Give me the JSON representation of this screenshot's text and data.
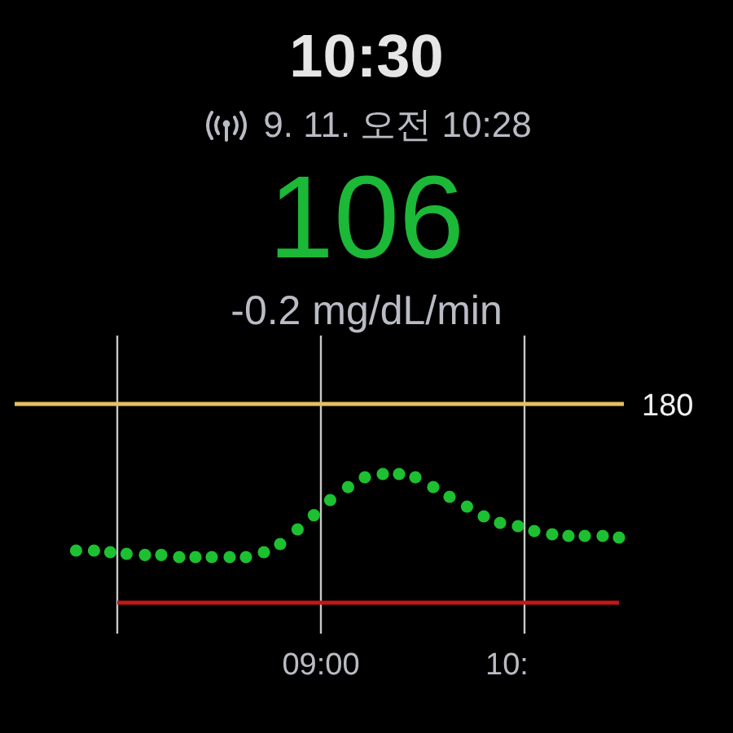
{
  "clock": "10:30",
  "status": {
    "timestamp": "9. 11. 오전 10:28"
  },
  "glucose": {
    "value": "106",
    "rate": "-0.2 mg/dL/min"
  },
  "chart": {
    "high_label": "180",
    "time_labels": [
      "09:00",
      "10:"
    ]
  }
}
